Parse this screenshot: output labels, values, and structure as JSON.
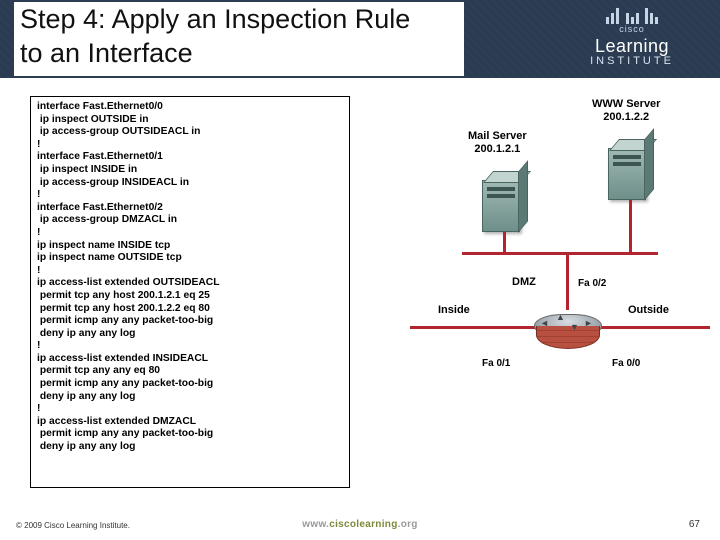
{
  "header": {
    "title_line1": "Step 4: Apply an Inspection Rule",
    "title_line2": "to an Interface",
    "logo_brand": "Learning",
    "logo_sub": "INSTITUTE",
    "logo_cisco": "cisco"
  },
  "code": {
    "lines": "interface Fast.Ethernet0/0\n ip inspect OUTSIDE in\n ip access-group OUTSIDEACL in\n!\ninterface Fast.Ethernet0/1\n ip inspect INSIDE in\n ip access-group INSIDEACL in\n!\ninterface Fast.Ethernet0/2\n ip access-group DMZACL in\n!\nip inspect name INSIDE tcp\nip inspect name OUTSIDE tcp\n!\nip access-list extended OUTSIDEACL\n permit tcp any host 200.1.2.1 eq 25\n permit tcp any host 200.1.2.2 eq 80\n permit icmp any any packet-too-big\n deny ip any any log\n!\nip access-list extended INSIDEACL\n permit tcp any any eq 80\n permit icmp any any packet-too-big\n deny ip any any log\n!\nip access-list extended DMZACL\n permit icmp any any packet-too-big\n deny ip any any log"
  },
  "diagram": {
    "mail_label": "Mail Server",
    "mail_ip": "200.1.2.1",
    "www_label": "WWW Server",
    "www_ip": "200.1.2.2",
    "dmz": "DMZ",
    "inside": "Inside",
    "outside": "Outside",
    "fa00": "Fa 0/0",
    "fa01": "Fa 0/1",
    "fa02": "Fa 0/2"
  },
  "footer": {
    "copyright": "© 2009 Cisco Learning Institute.",
    "url_prefix": "www.",
    "url_main": "ciscolearning",
    "url_suffix": ".org",
    "page": "67"
  }
}
